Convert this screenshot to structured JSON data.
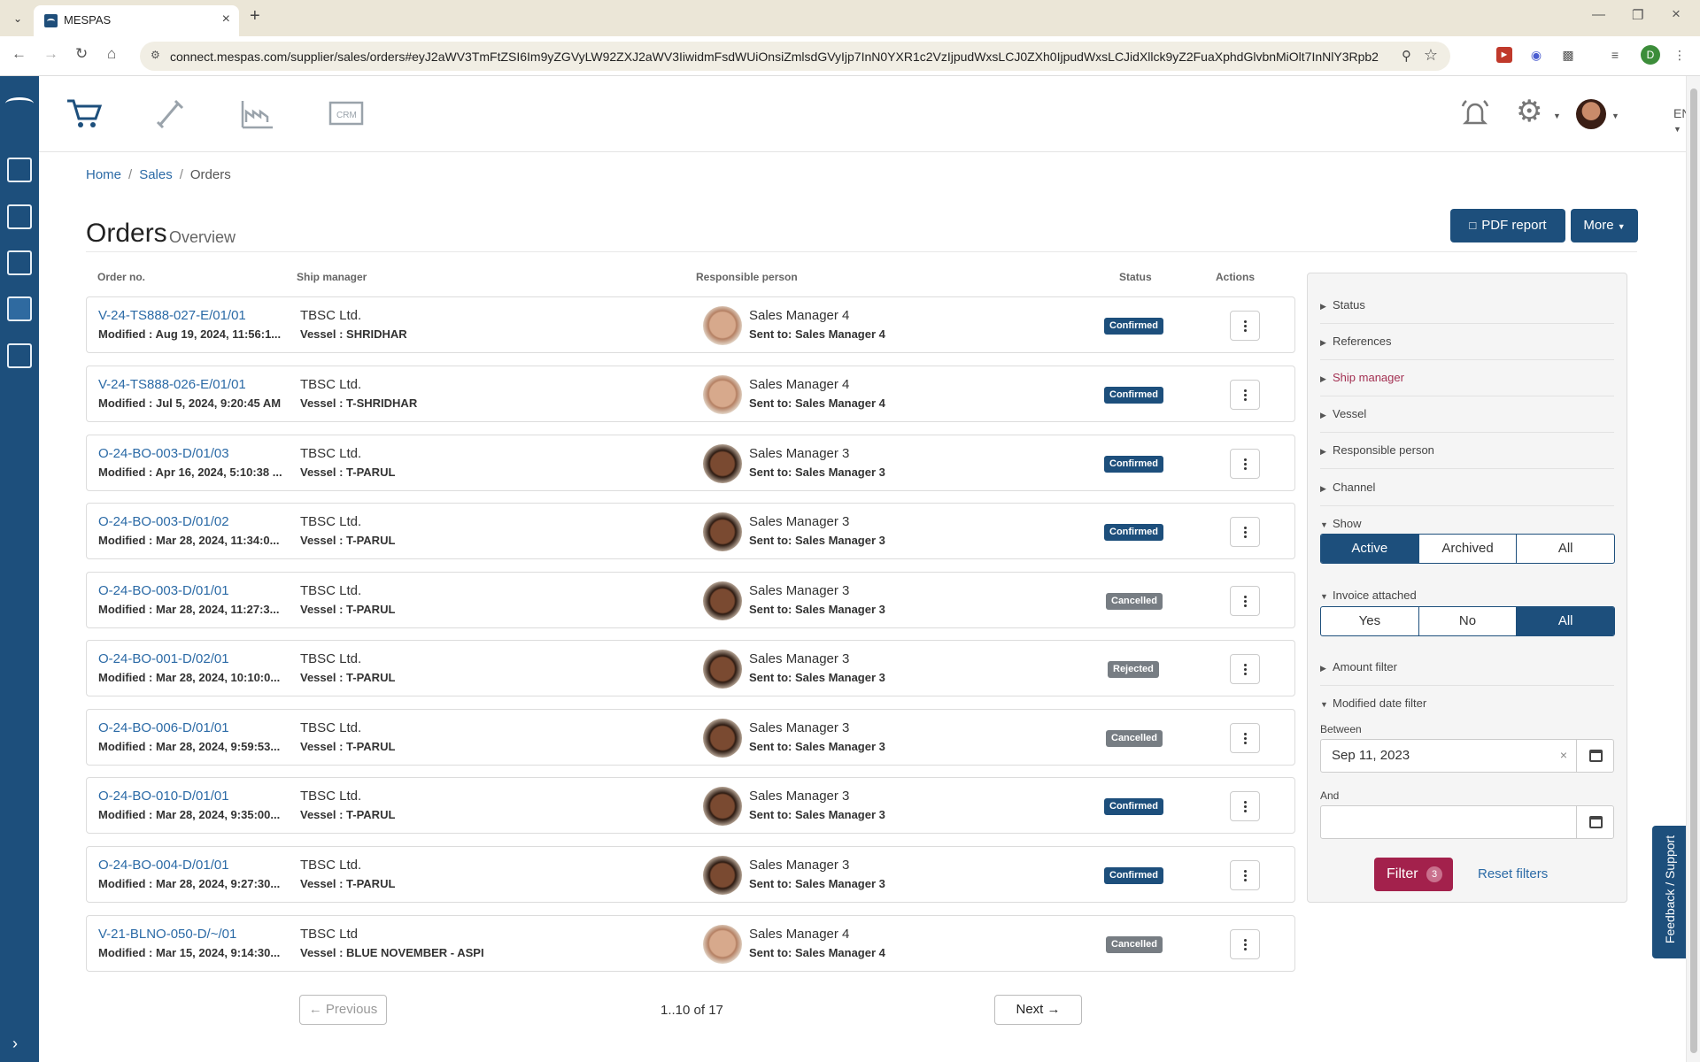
{
  "browser": {
    "tab_title": "MESPAS",
    "url": "connect.mespas.com/supplier/sales/orders#eyJ2aWV3TmFtZSI6Im9yZGVyLW92ZXJ2aWV3IiwidmFsdWUiOnsiZmlsdGVyIjp7InN0YXR1c2VzIjpudWxsLCJ0ZXh0IjpudWxsLCJidXllck9yZ2FuaXphdGlvbnMiOlt7InNlY3Rpb25JZCI6IjEiLCJ...",
    "profile_initial": "D"
  },
  "breadcrumb": {
    "home": "Home",
    "sales": "Sales",
    "current": "Orders",
    "sep": "/"
  },
  "page": {
    "title": "Orders",
    "subtitle": "Overview"
  },
  "buttons": {
    "pdf": "PDF report",
    "more": "More"
  },
  "lang": "EN",
  "table": {
    "headers": {
      "order_no": "Order no.",
      "ship_manager": "Ship manager",
      "responsible": "Responsible person",
      "status": "Status",
      "actions": "Actions"
    },
    "rows": [
      {
        "order_no": "V-24-TS888-027-E/01/01",
        "modified": "Modified : Aug 19, 2024, 11:56:1...",
        "company": "TBSC Ltd.",
        "vessel": "Vessel : SHRIDHAR",
        "person": "Sales Manager 4",
        "sent": "Sent to: Sales Manager 4",
        "status": "Confirmed",
        "face": "m4"
      },
      {
        "order_no": "V-24-TS888-026-E/01/01",
        "modified": "Modified : Jul 5, 2024, 9:20:45 AM",
        "company": "TBSC Ltd.",
        "vessel": "Vessel : T-SHRIDHAR",
        "person": "Sales Manager 4",
        "sent": "Sent to: Sales Manager 4",
        "status": "Confirmed",
        "face": "m4"
      },
      {
        "order_no": "O-24-BO-003-D/01/03",
        "modified": "Modified : Apr 16, 2024, 5:10:38 ...",
        "company": "TBSC Ltd.",
        "vessel": "Vessel : T-PARUL",
        "person": "Sales Manager 3",
        "sent": "Sent to: Sales Manager 3",
        "status": "Confirmed",
        "face": "m3"
      },
      {
        "order_no": "O-24-BO-003-D/01/02",
        "modified": "Modified : Mar 28, 2024, 11:34:0...",
        "company": "TBSC Ltd.",
        "vessel": "Vessel : T-PARUL",
        "person": "Sales Manager 3",
        "sent": "Sent to: Sales Manager 3",
        "status": "Confirmed",
        "face": "m3"
      },
      {
        "order_no": "O-24-BO-003-D/01/01",
        "modified": "Modified : Mar 28, 2024, 11:27:3...",
        "company": "TBSC Ltd.",
        "vessel": "Vessel : T-PARUL",
        "person": "Sales Manager 3",
        "sent": "Sent to: Sales Manager 3",
        "status": "Cancelled",
        "face": "m3"
      },
      {
        "order_no": "O-24-BO-001-D/02/01",
        "modified": "Modified : Mar 28, 2024, 10:10:0...",
        "company": "TBSC Ltd.",
        "vessel": "Vessel : T-PARUL",
        "person": "Sales Manager 3",
        "sent": "Sent to: Sales Manager 3",
        "status": "Rejected",
        "face": "m3"
      },
      {
        "order_no": "O-24-BO-006-D/01/01",
        "modified": "Modified : Mar 28, 2024, 9:59:53...",
        "company": "TBSC Ltd.",
        "vessel": "Vessel : T-PARUL",
        "person": "Sales Manager 3",
        "sent": "Sent to: Sales Manager 3",
        "status": "Cancelled",
        "face": "m3"
      },
      {
        "order_no": "O-24-BO-010-D/01/01",
        "modified": "Modified : Mar 28, 2024, 9:35:00...",
        "company": "TBSC Ltd.",
        "vessel": "Vessel : T-PARUL",
        "person": "Sales Manager 3",
        "sent": "Sent to: Sales Manager 3",
        "status": "Confirmed",
        "face": "m3"
      },
      {
        "order_no": "O-24-BO-004-D/01/01",
        "modified": "Modified : Mar 28, 2024, 9:27:30...",
        "company": "TBSC Ltd.",
        "vessel": "Vessel : T-PARUL",
        "person": "Sales Manager 3",
        "sent": "Sent to: Sales Manager 3",
        "status": "Confirmed",
        "face": "m3"
      },
      {
        "order_no": "V-21-BLNO-050-D/~/01",
        "modified": "Modified : Mar 15, 2024, 9:14:30...",
        "company": "TBSC Ltd",
        "vessel": "Vessel : BLUE NOVEMBER - ASPI",
        "person": "Sales Manager 4",
        "sent": "Sent to: Sales Manager 4",
        "status": "Cancelled",
        "face": "m4"
      }
    ]
  },
  "pagination": {
    "previous": "Previous",
    "next": "Next",
    "info": "1..10 of 17"
  },
  "filters": {
    "sections": [
      "Status",
      "References",
      "Ship manager",
      "Vessel",
      "Responsible person",
      "Channel"
    ],
    "show": {
      "label": "Show",
      "options": [
        "Active",
        "Archived",
        "All"
      ],
      "selected": "Active"
    },
    "invoice": {
      "label": "Invoice attached",
      "options": [
        "Yes",
        "No",
        "All"
      ],
      "selected": "All"
    },
    "amount": "Amount filter",
    "modified": {
      "label": "Modified date filter",
      "between": "Between",
      "from_value": "Sep 11, 2023",
      "and": "And",
      "to_value": ""
    },
    "filter_btn": "Filter",
    "filter_count": "3",
    "reset": "Reset filters"
  },
  "feedback": "Feedback / Support",
  "colors": {
    "primary": "#1d4f7c",
    "accent": "#a3214c",
    "link": "#2b6aa6"
  }
}
